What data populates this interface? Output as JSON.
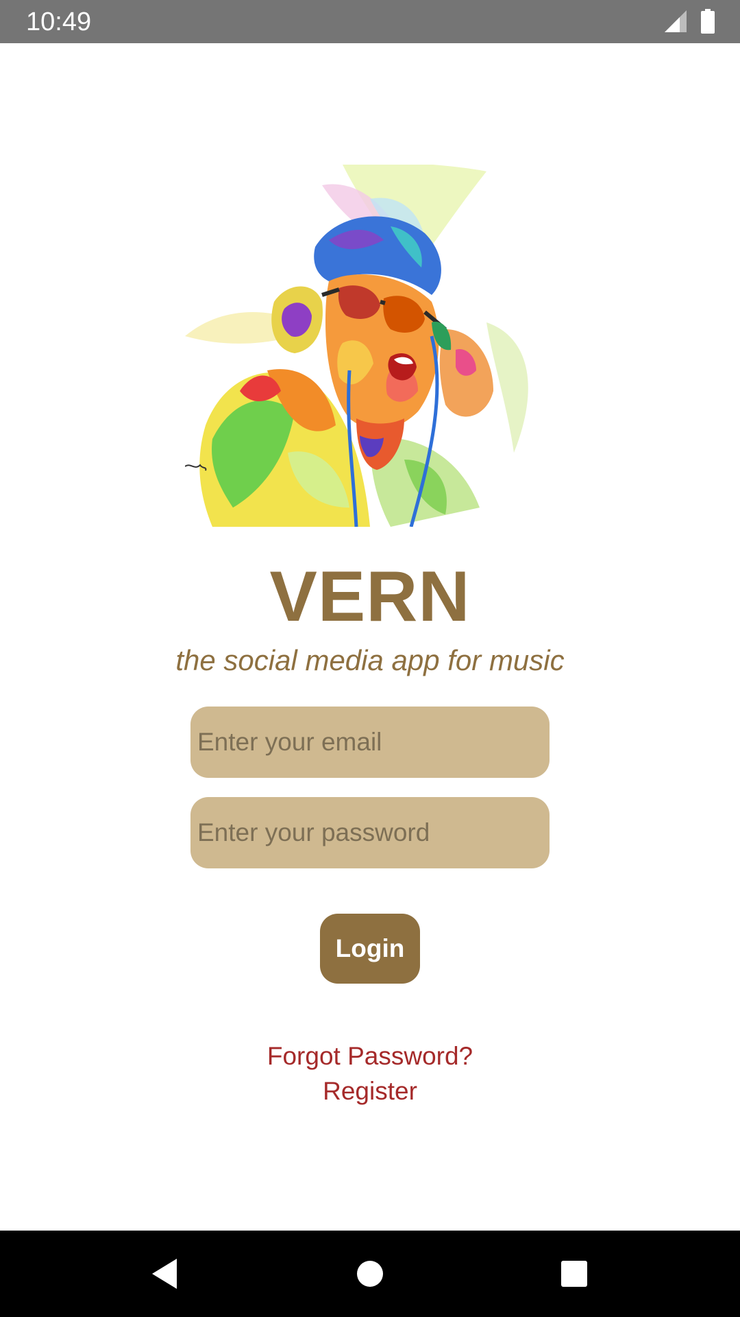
{
  "status_bar": {
    "time": "10:49",
    "icons": [
      "signal-icon",
      "battery-icon"
    ],
    "background_color": "#757575"
  },
  "hero": {
    "image": "colorful-dj-headphones-illustration"
  },
  "app": {
    "title": "VERN",
    "tagline": "the social media app for music",
    "brand_color": "#8e7040"
  },
  "login_form": {
    "email_placeholder": "Enter your email",
    "email_value": "",
    "password_placeholder": "Enter your password",
    "password_value": "",
    "field_color": "#cfb990",
    "login_label": "Login"
  },
  "links": {
    "forgot_password": "Forgot Password?",
    "register": "Register",
    "link_color": "#a52a2a"
  },
  "nav_bar": {
    "icons": [
      "back-icon",
      "home-icon",
      "recent-apps-icon"
    ]
  }
}
